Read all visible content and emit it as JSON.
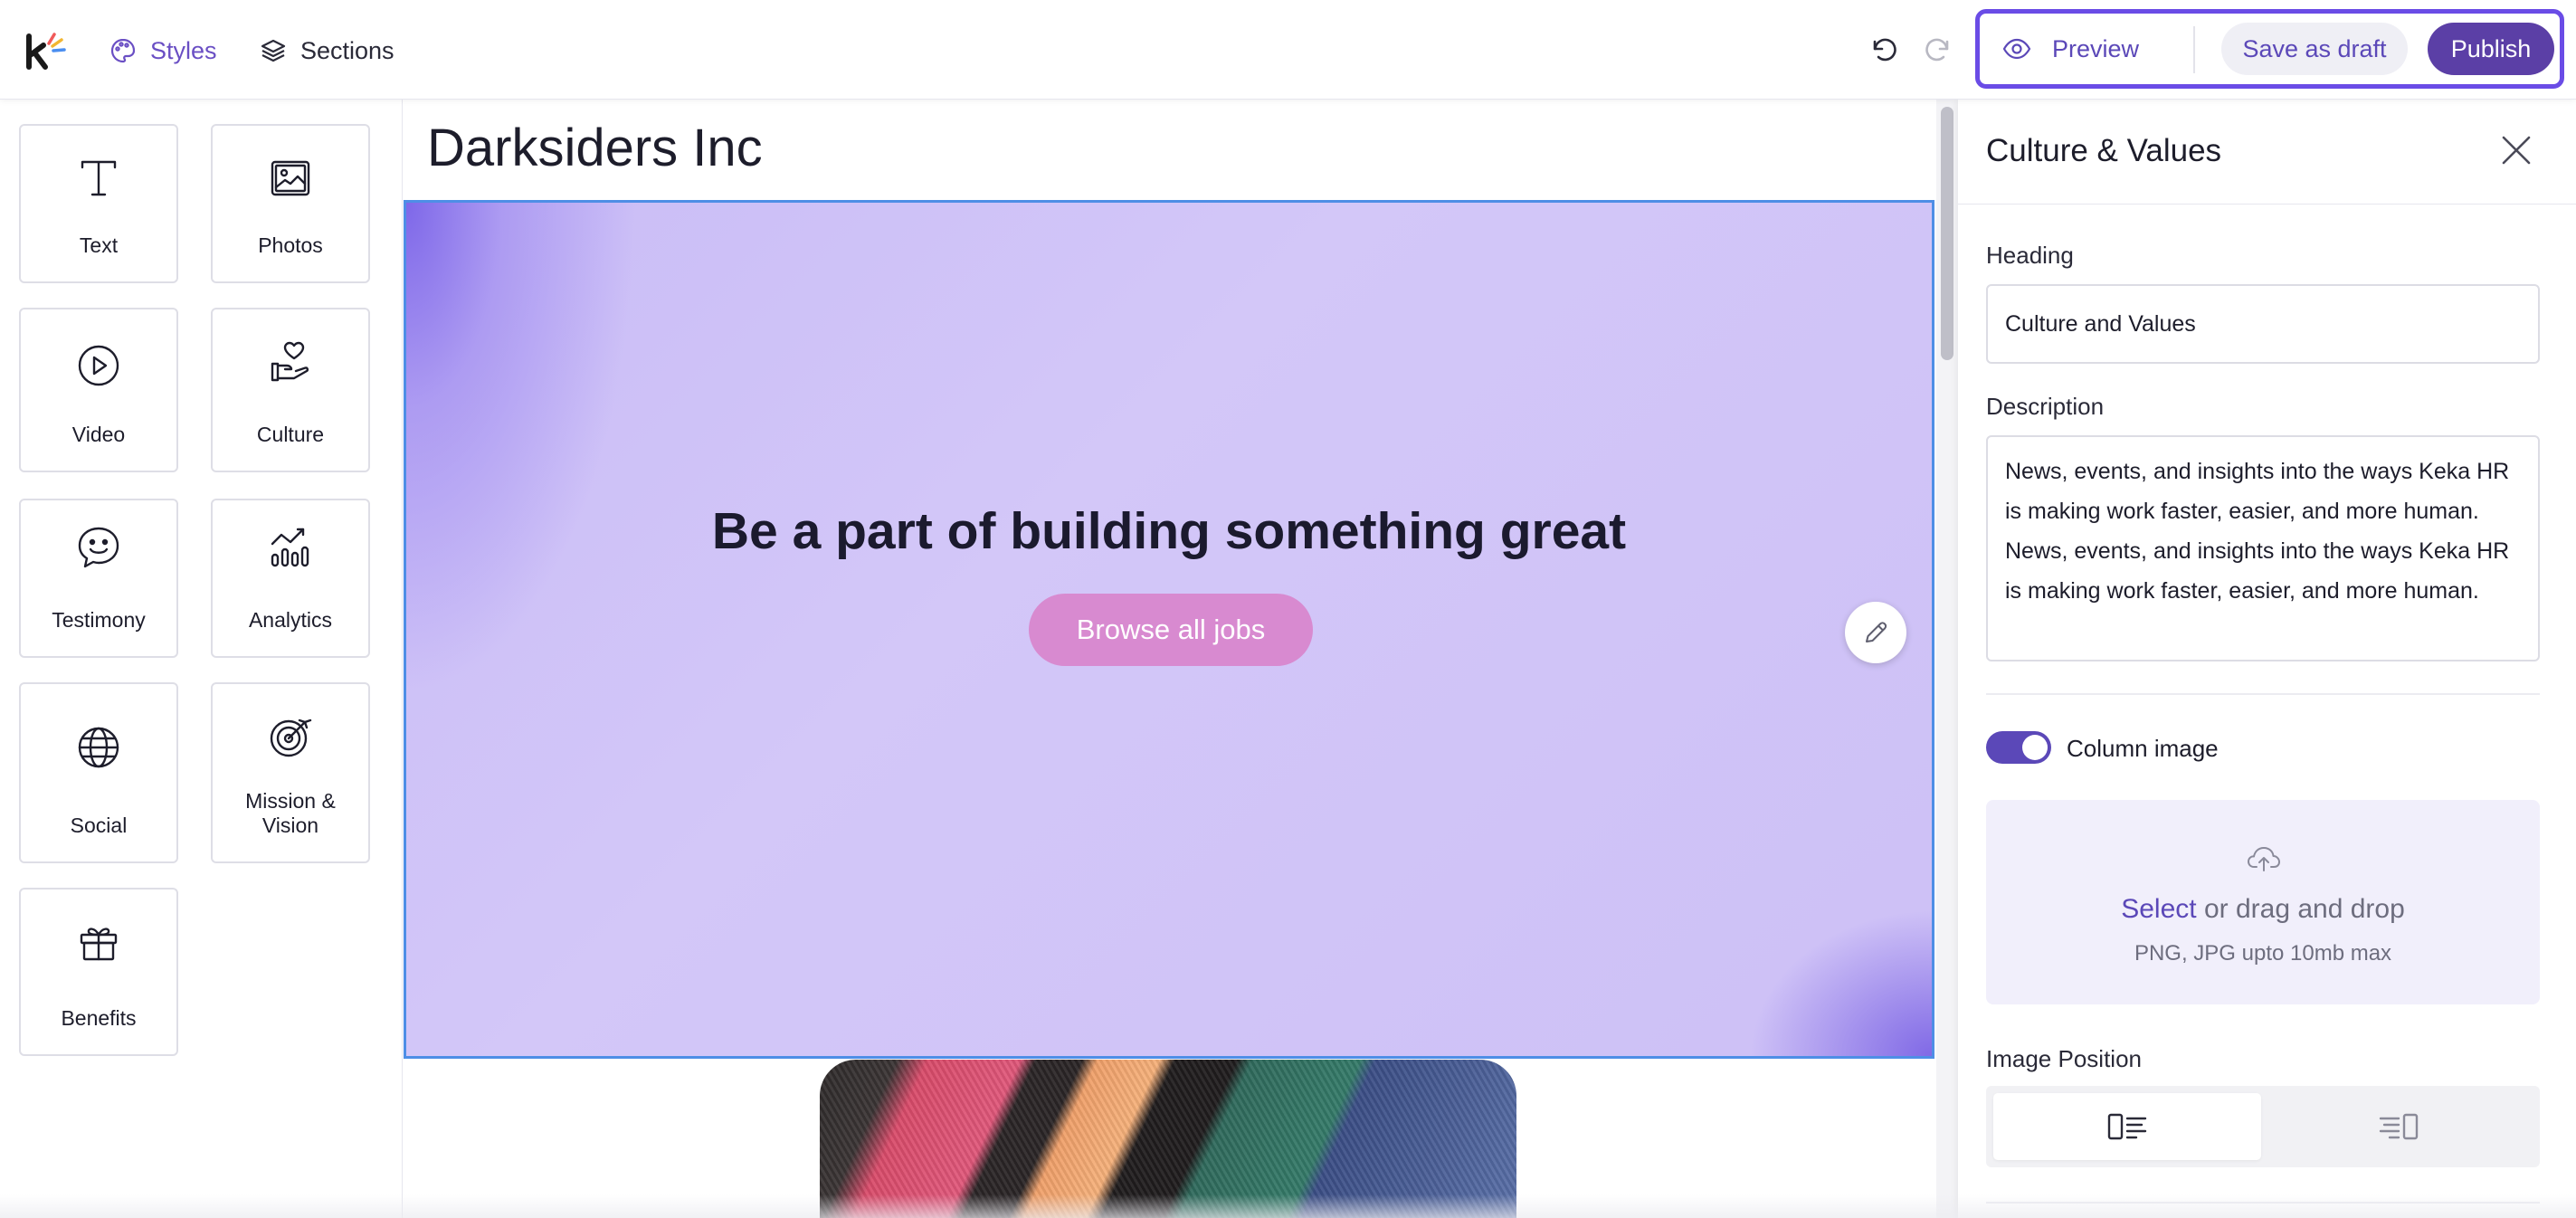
{
  "app": {
    "logo_icon": "keka-logo",
    "nav": {
      "styles_label": "Styles",
      "styles_icon": "palette-icon",
      "sections_label": "Sections",
      "sections_icon": "layers-icon"
    },
    "history": {
      "undo_icon": "undo-icon",
      "redo_icon": "redo-icon"
    },
    "actions": {
      "preview_label": "Preview",
      "preview_icon": "eye-icon",
      "save_draft_label": "Save as draft",
      "publish_label": "Publish"
    }
  },
  "sidebar": {
    "tiles": [
      {
        "label": "Text",
        "icon": "text-icon"
      },
      {
        "label": "Photos",
        "icon": "image-icon"
      },
      {
        "label": "Video",
        "icon": "play-icon"
      },
      {
        "label": "Culture",
        "icon": "heart-hand-icon"
      },
      {
        "label": "Testimony",
        "icon": "smile-icon"
      },
      {
        "label": "Analytics",
        "icon": "analytics-icon"
      },
      {
        "label": "Social",
        "icon": "globe-icon"
      },
      {
        "label": "Mission & Vision",
        "icon": "target-icon"
      },
      {
        "label": "Benefits",
        "icon": "gift-icon"
      }
    ]
  },
  "canvas": {
    "company_name": "Darksiders Inc",
    "hero": {
      "title": "Be a part of building something great",
      "cta_label": "Browse all jobs",
      "edit_icon": "pencil-icon"
    }
  },
  "panel": {
    "title": "Culture & Values",
    "close_icon": "close-icon",
    "heading_label": "Heading",
    "heading_value": "Culture and Values",
    "description_label": "Description",
    "description_value": "News, events, and insights into the ways Keka HR is making work faster, easier, and more human. News, events, and insights into the ways Keka HR is making work faster, easier, and more human.",
    "column_image_label": "Column image",
    "column_image_on": true,
    "upload": {
      "select_label": "Select",
      "rest_label": " or drag and drop",
      "hint": "PNG, JPG upto 10mb max",
      "icon": "cloud-upload-icon"
    },
    "image_position_label": "Image Position",
    "image_position_options": [
      "image-left-icon",
      "image-right-icon"
    ],
    "image_position_selected": "image-left-icon"
  },
  "colors": {
    "accent": "#5b48b8",
    "publish_bg": "#5b3fa6",
    "highlight_border": "#6a4ce6",
    "hero_bg": "#cdc0f6",
    "cta_bg": "#d88ad0",
    "selection_border": "#4e8ee6"
  }
}
